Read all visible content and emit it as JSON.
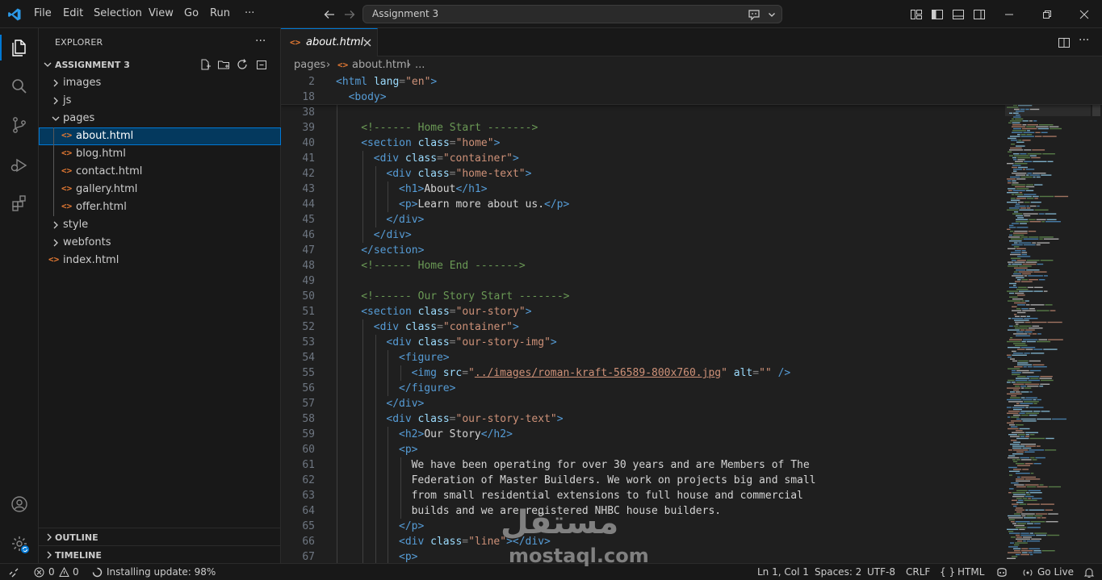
{
  "window": {
    "title": "Assignment 3"
  },
  "menu": [
    "File",
    "Edit",
    "Selection",
    "View",
    "Go",
    "Run",
    "···"
  ],
  "colors": {
    "accent": "#0078d4",
    "html_icon": "#e37933",
    "tag": "#569cd6",
    "attr": "#9cdcfe",
    "string": "#ce9178",
    "comment": "#6a9955"
  },
  "activity": {
    "top": [
      "files-icon",
      "search-icon",
      "source-control-icon",
      "run-debug-icon",
      "extensions-icon"
    ],
    "bottom": [
      "account-icon",
      "settings-gear-icon"
    ]
  },
  "explorer": {
    "title": "EXPLORER",
    "more": "···",
    "root": "ASSIGNMENT 3",
    "tree": [
      {
        "label": "images",
        "type": "folder",
        "expanded": false,
        "depth": 0
      },
      {
        "label": "js",
        "type": "folder",
        "expanded": false,
        "depth": 0
      },
      {
        "label": "pages",
        "type": "folder",
        "expanded": true,
        "depth": 0
      },
      {
        "label": "about.html",
        "type": "file",
        "depth": 1,
        "selected": true
      },
      {
        "label": "blog.html",
        "type": "file",
        "depth": 1
      },
      {
        "label": "contact.html",
        "type": "file",
        "depth": 1
      },
      {
        "label": "gallery.html",
        "type": "file",
        "depth": 1
      },
      {
        "label": "offer.html",
        "type": "file",
        "depth": 1
      },
      {
        "label": "style",
        "type": "folder",
        "expanded": false,
        "depth": 0
      },
      {
        "label": "webfonts",
        "type": "folder",
        "expanded": false,
        "depth": 0
      },
      {
        "label": "index.html",
        "type": "file",
        "depth": 0
      }
    ],
    "sections": [
      "OUTLINE",
      "TIMELINE"
    ]
  },
  "editor": {
    "tab": {
      "label": "about.html",
      "icon": "<>"
    },
    "breadcrumb": [
      "pages",
      "about.html",
      "..."
    ],
    "sticky": [
      {
        "n": "2",
        "indent": 0,
        "tokens": [
          [
            "tag",
            "<html"
          ],
          [
            "attr",
            " lang"
          ],
          [
            "pun",
            "="
          ],
          [
            "str",
            "\"en\""
          ],
          [
            "tag",
            ">"
          ]
        ]
      },
      {
        "n": "18",
        "indent": 1,
        "tokens": [
          [
            "tag",
            "<body>"
          ]
        ]
      }
    ],
    "lines": [
      {
        "n": "38",
        "indent": 2,
        "tokens": []
      },
      {
        "n": "39",
        "indent": 2,
        "tokens": [
          [
            "cmt",
            "<!------ Home Start ------->"
          ]
        ]
      },
      {
        "n": "40",
        "indent": 2,
        "tokens": [
          [
            "tag",
            "<section"
          ],
          [
            "attr",
            " class"
          ],
          [
            "pun",
            "="
          ],
          [
            "str",
            "\"home\""
          ],
          [
            "tag",
            ">"
          ]
        ]
      },
      {
        "n": "41",
        "indent": 3,
        "tokens": [
          [
            "tag",
            "<div"
          ],
          [
            "attr",
            " class"
          ],
          [
            "pun",
            "="
          ],
          [
            "str",
            "\"container\""
          ],
          [
            "tag",
            ">"
          ]
        ]
      },
      {
        "n": "42",
        "indent": 4,
        "tokens": [
          [
            "tag",
            "<div"
          ],
          [
            "attr",
            " class"
          ],
          [
            "pun",
            "="
          ],
          [
            "str",
            "\"home-text\""
          ],
          [
            "tag",
            ">"
          ]
        ]
      },
      {
        "n": "43",
        "indent": 5,
        "tokens": [
          [
            "tag",
            "<h1>"
          ],
          [
            "txt",
            "About"
          ],
          [
            "tag",
            "</h1>"
          ]
        ]
      },
      {
        "n": "44",
        "indent": 5,
        "tokens": [
          [
            "tag",
            "<p>"
          ],
          [
            "txt",
            "Learn more about us."
          ],
          [
            "tag",
            "</p>"
          ]
        ]
      },
      {
        "n": "45",
        "indent": 4,
        "tokens": [
          [
            "tag",
            "</div>"
          ]
        ]
      },
      {
        "n": "46",
        "indent": 3,
        "tokens": [
          [
            "tag",
            "</div>"
          ]
        ]
      },
      {
        "n": "47",
        "indent": 2,
        "tokens": [
          [
            "tag",
            "</section>"
          ]
        ]
      },
      {
        "n": "48",
        "indent": 2,
        "tokens": [
          [
            "cmt",
            "<!------ Home End ------->"
          ]
        ]
      },
      {
        "n": "49",
        "indent": 2,
        "tokens": []
      },
      {
        "n": "50",
        "indent": 2,
        "tokens": [
          [
            "cmt",
            "<!------ Our Story Start ------->"
          ]
        ]
      },
      {
        "n": "51",
        "indent": 2,
        "tokens": [
          [
            "tag",
            "<section"
          ],
          [
            "attr",
            " class"
          ],
          [
            "pun",
            "="
          ],
          [
            "str",
            "\"our-story\""
          ],
          [
            "tag",
            ">"
          ]
        ]
      },
      {
        "n": "52",
        "indent": 3,
        "tokens": [
          [
            "tag",
            "<div"
          ],
          [
            "attr",
            " class"
          ],
          [
            "pun",
            "="
          ],
          [
            "str",
            "\"container\""
          ],
          [
            "tag",
            ">"
          ]
        ]
      },
      {
        "n": "53",
        "indent": 4,
        "tokens": [
          [
            "tag",
            "<div"
          ],
          [
            "attr",
            " class"
          ],
          [
            "pun",
            "="
          ],
          [
            "str",
            "\"our-story-img\""
          ],
          [
            "tag",
            ">"
          ]
        ]
      },
      {
        "n": "54",
        "indent": 5,
        "tokens": [
          [
            "tag",
            "<figure>"
          ]
        ]
      },
      {
        "n": "55",
        "indent": 6,
        "tokens": [
          [
            "tag",
            "<img"
          ],
          [
            "attr",
            " src"
          ],
          [
            "pun",
            "="
          ],
          [
            "str",
            "\""
          ],
          [
            "link",
            "../images/roman-kraft-56589-800x760.jpg"
          ],
          [
            "str",
            "\""
          ],
          [
            "attr",
            " alt"
          ],
          [
            "pun",
            "="
          ],
          [
            "str",
            "\"\""
          ],
          [
            "tag",
            " />"
          ]
        ]
      },
      {
        "n": "56",
        "indent": 5,
        "tokens": [
          [
            "tag",
            "</figure>"
          ]
        ]
      },
      {
        "n": "57",
        "indent": 4,
        "tokens": [
          [
            "tag",
            "</div>"
          ]
        ]
      },
      {
        "n": "58",
        "indent": 4,
        "tokens": [
          [
            "tag",
            "<div"
          ],
          [
            "attr",
            " class"
          ],
          [
            "pun",
            "="
          ],
          [
            "str",
            "\"our-story-text\""
          ],
          [
            "tag",
            ">"
          ]
        ]
      },
      {
        "n": "59",
        "indent": 5,
        "tokens": [
          [
            "tag",
            "<h2>"
          ],
          [
            "txt",
            "Our Story"
          ],
          [
            "tag",
            "</h2>"
          ]
        ]
      },
      {
        "n": "60",
        "indent": 5,
        "tokens": [
          [
            "tag",
            "<p>"
          ]
        ]
      },
      {
        "n": "61",
        "indent": 6,
        "tokens": [
          [
            "txt",
            "We have been operating for over 30 years and are Members of The"
          ]
        ]
      },
      {
        "n": "62",
        "indent": 6,
        "tokens": [
          [
            "txt",
            "Federation of Master Builders. We work on projects big and small"
          ]
        ]
      },
      {
        "n": "63",
        "indent": 6,
        "tokens": [
          [
            "txt",
            "from small residential extensions to full house and commercial"
          ]
        ]
      },
      {
        "n": "64",
        "indent": 6,
        "tokens": [
          [
            "txt",
            "builds and we are registered NHBC house builders."
          ]
        ]
      },
      {
        "n": "65",
        "indent": 5,
        "tokens": [
          [
            "tag",
            "</p>"
          ]
        ]
      },
      {
        "n": "66",
        "indent": 5,
        "tokens": [
          [
            "tag",
            "<div"
          ],
          [
            "attr",
            " class"
          ],
          [
            "pun",
            "="
          ],
          [
            "str",
            "\"line\""
          ],
          [
            "tag",
            "></div>"
          ]
        ]
      },
      {
        "n": "67",
        "indent": 5,
        "tokens": [
          [
            "tag",
            "<p>"
          ]
        ]
      }
    ]
  },
  "statusbar": {
    "problems_errors": "0",
    "problems_warnings": "0",
    "update": "Installing update: 98%",
    "cursor": "Ln 1, Col 1",
    "spaces": "Spaces: 2",
    "encoding": "UTF-8",
    "eol": "CRLF",
    "language": "HTML",
    "golive": "Go Live"
  },
  "watermark": {
    "arabic": "مستقل",
    "latin": "mostaql.com"
  }
}
